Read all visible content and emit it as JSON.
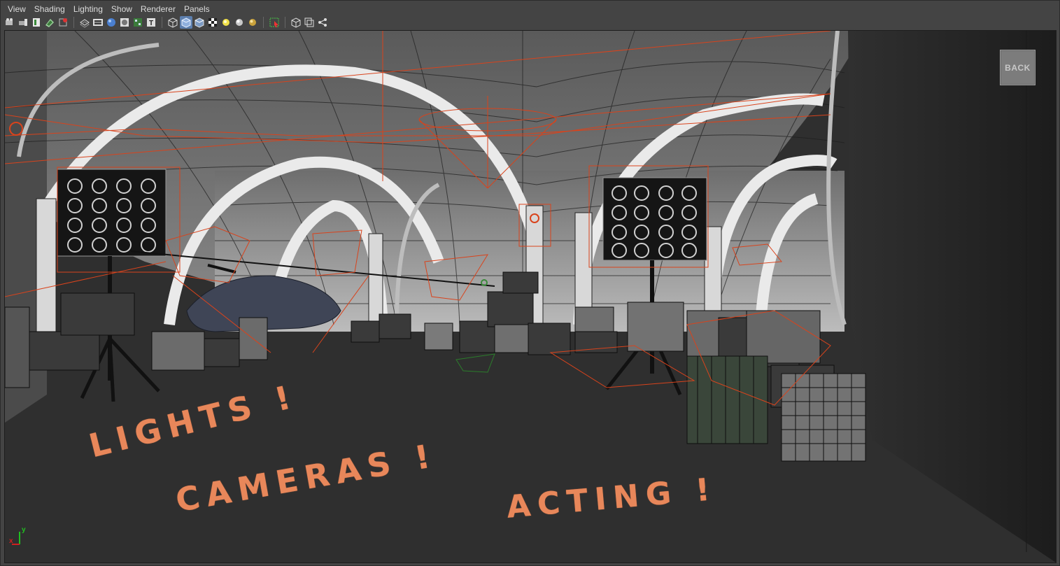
{
  "menu": {
    "items": [
      "View",
      "Shading",
      "Lighting",
      "Show",
      "Renderer",
      "Panels"
    ]
  },
  "toolbar": {
    "groups": [
      [
        "camera-select-icon",
        "camera-attributes-icon",
        "bookmarks-icon",
        "image-plane-icon",
        "grid-icon"
      ],
      [
        "wireframe-icon",
        "smooth-shade-icon",
        "bounding-box-icon",
        "points-icon",
        "textured-icon",
        "x-ray-icon"
      ],
      [
        "shaded-cube-icon",
        "wireframe-on-shaded-icon",
        "default-material-icon",
        "use-all-lights-icon",
        "shadows-icon",
        "ambient-occlusion-icon",
        "motion-blur-icon"
      ],
      [
        "select-camera-icon"
      ],
      [
        "isolate-select-icon",
        "two-sided-lighting-icon",
        "hud-icon"
      ]
    ]
  },
  "viewport": {
    "back_label": "BACK",
    "annotations": {
      "lights": "LIGHTS !",
      "cameras": "CAMERAS !",
      "acting": "ACTING !"
    },
    "axis": {
      "y": "y",
      "x": "x"
    },
    "colors": {
      "background": "#2e2e2e",
      "wireframe": "#1a1a1a",
      "light_helpers": "#d9431c",
      "annotation": "#e8875a",
      "axis_x": "#d02020",
      "axis_y": "#20c020"
    }
  }
}
